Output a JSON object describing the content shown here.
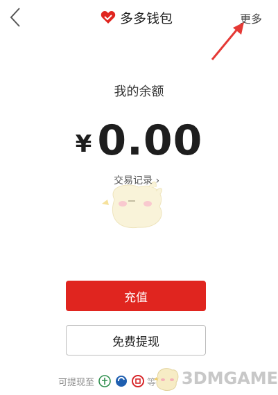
{
  "header": {
    "back_icon": "chevron-left-icon",
    "logo_icon": "red-heart-icon",
    "title": "多多钱包",
    "more_label": "更多"
  },
  "balance": {
    "label": "我的余额",
    "currency": "¥",
    "amount": "0.00",
    "records_label": "交易记录 ›"
  },
  "actions": {
    "recharge_label": "充值",
    "withdraw_label": "免费提现"
  },
  "footer": {
    "withdraw_to_label": "可提现至",
    "bank_icons": [
      "abc-bank-icon",
      "ccb-bank-icon",
      "icbc-bank-icon"
    ],
    "note": "等2"
  },
  "watermark": {
    "text": "3DMGAME"
  },
  "colors": {
    "accent_red": "#e0251f",
    "annotation_arrow": "#e53935"
  }
}
